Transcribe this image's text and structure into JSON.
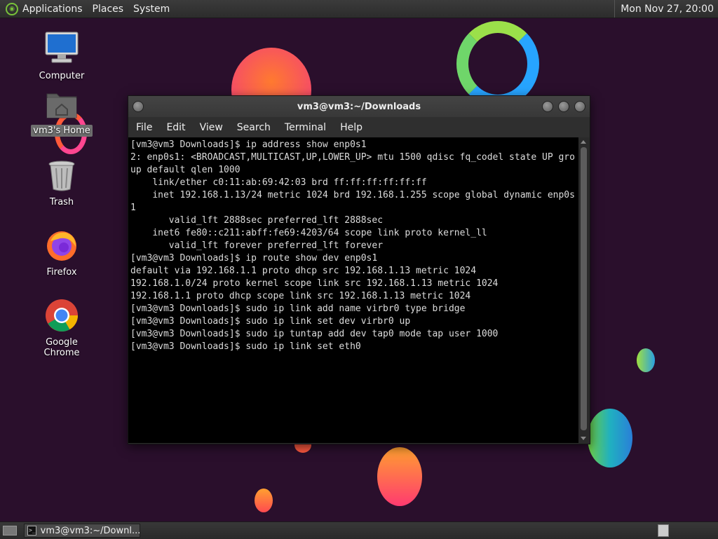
{
  "top_panel": {
    "menus": [
      "Applications",
      "Places",
      "System"
    ],
    "clock": "Mon Nov 27, 20:00"
  },
  "desktop": {
    "icons": [
      {
        "label": "Computer",
        "icon": "computer-icon"
      },
      {
        "label": "vm3's Home",
        "icon": "home-folder-icon",
        "selected": true
      },
      {
        "label": "Trash",
        "icon": "trash-icon"
      },
      {
        "label": "Firefox",
        "icon": "firefox-icon"
      },
      {
        "label": "Google Chrome",
        "icon": "chrome-icon"
      }
    ]
  },
  "terminal": {
    "title": "vm3@vm3:~/Downloads",
    "menu": [
      "File",
      "Edit",
      "View",
      "Search",
      "Terminal",
      "Help"
    ],
    "lines": [
      "[vm3@vm3 Downloads]$ ip address show enp0s1",
      "2: enp0s1: <BROADCAST,MULTICAST,UP,LOWER_UP> mtu 1500 qdisc fq_codel state UP group default qlen 1000",
      "    link/ether c0:11:ab:69:42:03 brd ff:ff:ff:ff:ff:ff",
      "    inet 192.168.1.13/24 metric 1024 brd 192.168.1.255 scope global dynamic enp0s1",
      "       valid_lft 2888sec preferred_lft 2888sec",
      "    inet6 fe80::c211:abff:fe69:4203/64 scope link proto kernel_ll",
      "       valid_lft forever preferred_lft forever",
      "[vm3@vm3 Downloads]$ ip route show dev enp0s1",
      "default via 192.168.1.1 proto dhcp src 192.168.1.13 metric 1024",
      "192.168.1.0/24 proto kernel scope link src 192.168.1.13 metric 1024",
      "192.168.1.1 proto dhcp scope link src 192.168.1.13 metric 1024",
      "[vm3@vm3 Downloads]$ sudo ip link add name virbr0 type bridge",
      "[vm3@vm3 Downloads]$ sudo ip link set dev virbr0 up",
      "[vm3@vm3 Downloads]$ sudo ip tuntap add dev tap0 mode tap user 1000",
      "[vm3@vm3 Downloads]$ sudo ip link set eth0"
    ]
  },
  "bottom_panel": {
    "task_label": "vm3@vm3:~/Downl...",
    "task_icon_text": ">_"
  }
}
